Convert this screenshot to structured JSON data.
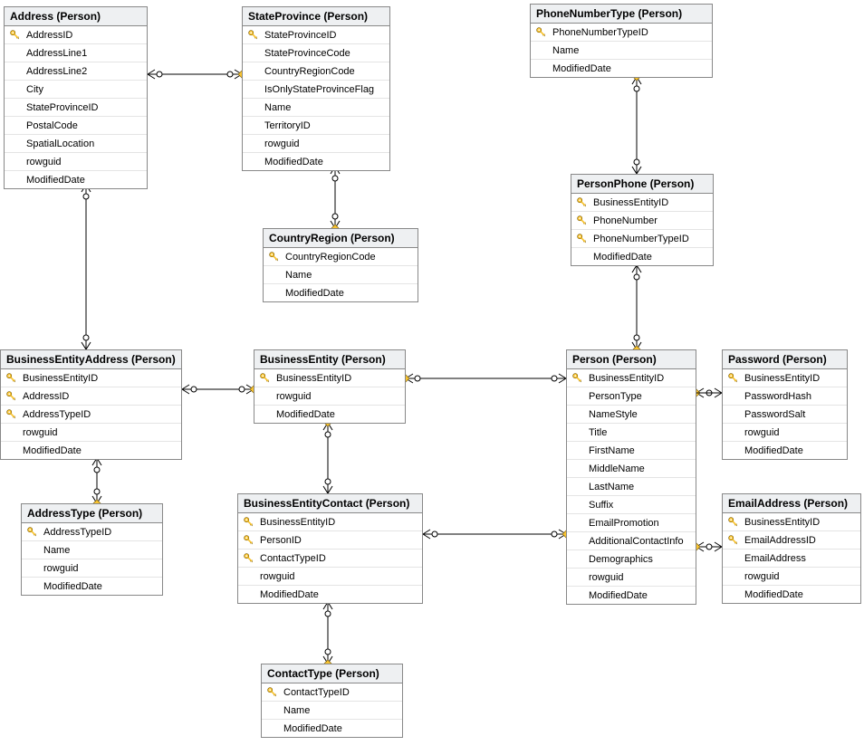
{
  "entities": {
    "Address": {
      "title": "Address (Person)",
      "columns": [
        {
          "name": "AddressID",
          "pk": true
        },
        {
          "name": "AddressLine1",
          "pk": false
        },
        {
          "name": "AddressLine2",
          "pk": false
        },
        {
          "name": "City",
          "pk": false
        },
        {
          "name": "StateProvinceID",
          "pk": false
        },
        {
          "name": "PostalCode",
          "pk": false
        },
        {
          "name": "SpatialLocation",
          "pk": false
        },
        {
          "name": "rowguid",
          "pk": false
        },
        {
          "name": "ModifiedDate",
          "pk": false
        }
      ]
    },
    "StateProvince": {
      "title": "StateProvince (Person)",
      "columns": [
        {
          "name": "StateProvinceID",
          "pk": true
        },
        {
          "name": "StateProvinceCode",
          "pk": false
        },
        {
          "name": "CountryRegionCode",
          "pk": false
        },
        {
          "name": "IsOnlyStateProvinceFlag",
          "pk": false
        },
        {
          "name": "Name",
          "pk": false
        },
        {
          "name": "TerritoryID",
          "pk": false
        },
        {
          "name": "rowguid",
          "pk": false
        },
        {
          "name": "ModifiedDate",
          "pk": false
        }
      ]
    },
    "PhoneNumberType": {
      "title": "PhoneNumberType (Person)",
      "columns": [
        {
          "name": "PhoneNumberTypeID",
          "pk": true
        },
        {
          "name": "Name",
          "pk": false
        },
        {
          "name": "ModifiedDate",
          "pk": false
        }
      ]
    },
    "CountryRegion": {
      "title": "CountryRegion (Person)",
      "columns": [
        {
          "name": "CountryRegionCode",
          "pk": true
        },
        {
          "name": "Name",
          "pk": false
        },
        {
          "name": "ModifiedDate",
          "pk": false
        }
      ]
    },
    "PersonPhone": {
      "title": "PersonPhone (Person)",
      "columns": [
        {
          "name": "BusinessEntityID",
          "pk": true
        },
        {
          "name": "PhoneNumber",
          "pk": true
        },
        {
          "name": "PhoneNumberTypeID",
          "pk": true
        },
        {
          "name": "ModifiedDate",
          "pk": false
        }
      ]
    },
    "BusinessEntityAddress": {
      "title": "BusinessEntityAddress (Person)",
      "columns": [
        {
          "name": "BusinessEntityID",
          "pk": true
        },
        {
          "name": "AddressID",
          "pk": true
        },
        {
          "name": "AddressTypeID",
          "pk": true
        },
        {
          "name": "rowguid",
          "pk": false
        },
        {
          "name": "ModifiedDate",
          "pk": false
        }
      ]
    },
    "BusinessEntity": {
      "title": "BusinessEntity (Person)",
      "columns": [
        {
          "name": "BusinessEntityID",
          "pk": true
        },
        {
          "name": "rowguid",
          "pk": false
        },
        {
          "name": "ModifiedDate",
          "pk": false
        }
      ]
    },
    "Person": {
      "title": "Person (Person)",
      "columns": [
        {
          "name": "BusinessEntityID",
          "pk": true
        },
        {
          "name": "PersonType",
          "pk": false
        },
        {
          "name": "NameStyle",
          "pk": false
        },
        {
          "name": "Title",
          "pk": false
        },
        {
          "name": "FirstName",
          "pk": false
        },
        {
          "name": "MiddleName",
          "pk": false
        },
        {
          "name": "LastName",
          "pk": false
        },
        {
          "name": "Suffix",
          "pk": false
        },
        {
          "name": "EmailPromotion",
          "pk": false
        },
        {
          "name": "AdditionalContactInfo",
          "pk": false
        },
        {
          "name": "Demographics",
          "pk": false
        },
        {
          "name": "rowguid",
          "pk": false
        },
        {
          "name": "ModifiedDate",
          "pk": false
        }
      ]
    },
    "Password": {
      "title": "Password (Person)",
      "columns": [
        {
          "name": "BusinessEntityID",
          "pk": true
        },
        {
          "name": "PasswordHash",
          "pk": false
        },
        {
          "name": "PasswordSalt",
          "pk": false
        },
        {
          "name": "rowguid",
          "pk": false
        },
        {
          "name": "ModifiedDate",
          "pk": false
        }
      ]
    },
    "AddressType": {
      "title": "AddressType (Person)",
      "columns": [
        {
          "name": "AddressTypeID",
          "pk": true
        },
        {
          "name": "Name",
          "pk": false
        },
        {
          "name": "rowguid",
          "pk": false
        },
        {
          "name": "ModifiedDate",
          "pk": false
        }
      ]
    },
    "BusinessEntityContact": {
      "title": "BusinessEntityContact (Person)",
      "columns": [
        {
          "name": "BusinessEntityID",
          "pk": true
        },
        {
          "name": "PersonID",
          "pk": true
        },
        {
          "name": "ContactTypeID",
          "pk": true
        },
        {
          "name": "rowguid",
          "pk": false
        },
        {
          "name": "ModifiedDate",
          "pk": false
        }
      ]
    },
    "EmailAddress": {
      "title": "EmailAddress (Person)",
      "columns": [
        {
          "name": "BusinessEntityID",
          "pk": true
        },
        {
          "name": "EmailAddressID",
          "pk": true
        },
        {
          "name": "EmailAddress",
          "pk": false
        },
        {
          "name": "rowguid",
          "pk": false
        },
        {
          "name": "ModifiedDate",
          "pk": false
        }
      ]
    },
    "ContactType": {
      "title": "ContactType (Person)",
      "columns": [
        {
          "name": "ContactTypeID",
          "pk": true
        },
        {
          "name": "Name",
          "pk": false
        },
        {
          "name": "ModifiedDate",
          "pk": false
        }
      ]
    }
  },
  "relationships": [
    {
      "from": "Address",
      "to": "StateProvince"
    },
    {
      "from": "Address",
      "to": "BusinessEntityAddress"
    },
    {
      "from": "StateProvince",
      "to": "CountryRegion"
    },
    {
      "from": "PhoneNumberType",
      "to": "PersonPhone"
    },
    {
      "from": "PersonPhone",
      "to": "Person"
    },
    {
      "from": "BusinessEntityAddress",
      "to": "BusinessEntity"
    },
    {
      "from": "BusinessEntityAddress",
      "to": "AddressType"
    },
    {
      "from": "BusinessEntity",
      "to": "Person"
    },
    {
      "from": "BusinessEntity",
      "to": "BusinessEntityContact"
    },
    {
      "from": "BusinessEntityContact",
      "to": "Person"
    },
    {
      "from": "BusinessEntityContact",
      "to": "ContactType"
    },
    {
      "from": "Person",
      "to": "Password"
    },
    {
      "from": "Person",
      "to": "EmailAddress"
    }
  ]
}
